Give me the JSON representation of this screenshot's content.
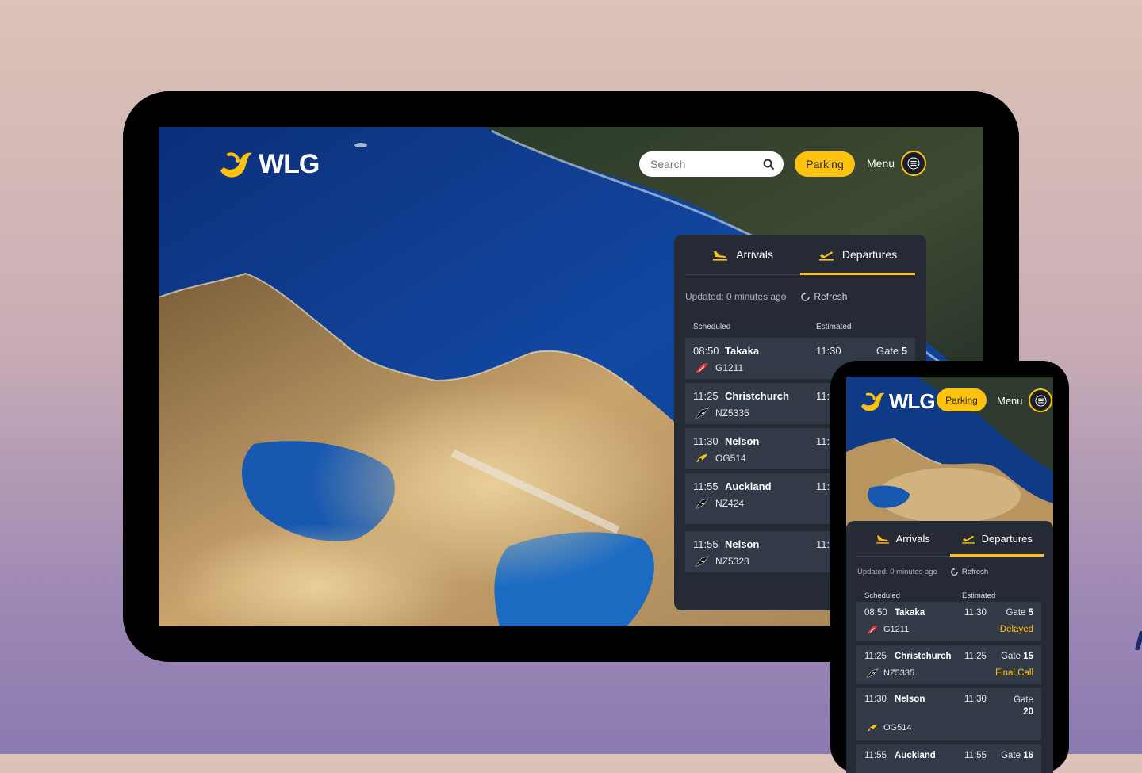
{
  "app": {
    "logo_text": "WLG",
    "search_placeholder": "Search",
    "parking_label": "Parking",
    "menu_label": "Menu"
  },
  "flights": {
    "tabs": [
      {
        "label": "Arrivals",
        "icon": "plane-arrival-icon"
      },
      {
        "label": "Departures",
        "icon": "plane-departure-icon",
        "active": true
      }
    ],
    "updated_text": "Updated: 0 minutes ago",
    "refresh_label": "Refresh",
    "columns": {
      "scheduled": "Scheduled",
      "estimated": "Estimated"
    },
    "rows": [
      {
        "time": "08:50",
        "city": "Takaka",
        "estimated": "11:30",
        "gate_label": "Gate",
        "gate": "5",
        "flight": "G1211",
        "airline": "golden-bay-air-icon",
        "status": "Delayed"
      },
      {
        "time": "11:25",
        "city": "Christchurch",
        "estimated": "11:25",
        "gate_label": "Gate",
        "gate": "15",
        "flight": "NZ5335",
        "airline": "air-new-zealand-icon",
        "status": "Final Call"
      },
      {
        "time": "11:30",
        "city": "Nelson",
        "estimated": "11:30",
        "gate_label": "Gate",
        "gate": "20",
        "flight": "OG514",
        "airline": "originair-icon",
        "status": ""
      },
      {
        "time": "11:55",
        "city": "Auckland",
        "estimated": "11:55",
        "gate_label": "Gate",
        "gate": "16",
        "flight": "NZ424",
        "airline": "air-new-zealand-icon",
        "status": ""
      },
      {
        "time": "11:55",
        "city": "Nelson",
        "estimated": "11:55",
        "gate_label": "Gate",
        "gate": "",
        "flight": "NZ5323",
        "airline": "air-new-zealand-icon",
        "status": ""
      }
    ],
    "tablet_estimated_visible": [
      "11:30",
      "11:2",
      "11:3",
      "11:5",
      "11:5"
    ]
  },
  "colors": {
    "accent": "#ffc20e",
    "panel": "#252a35",
    "row": "#333a47",
    "ocean": "#0f3a86"
  }
}
